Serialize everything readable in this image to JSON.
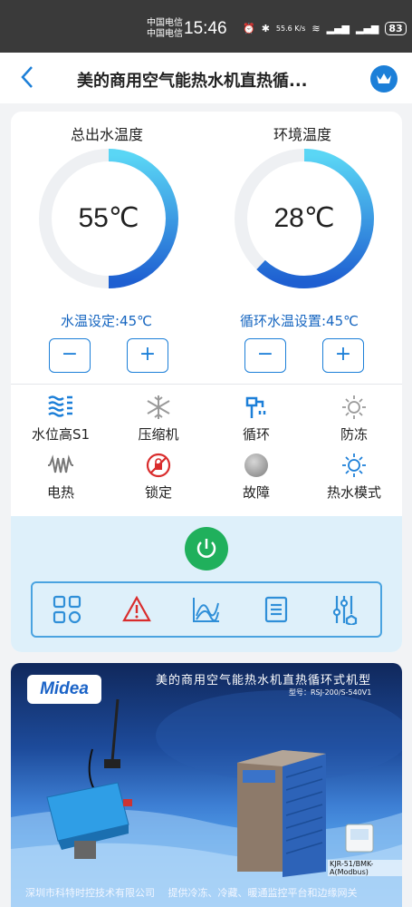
{
  "status_bar": {
    "carrier_1": "中国电信",
    "carrier_2": "中国电信",
    "time": "15:46",
    "net_speed": "55.6 K/s",
    "battery": "83"
  },
  "header": {
    "title": "美的商用空气能热水机直热循...",
    "back_icon": "chevron-left-icon",
    "crown_icon": "crown-icon"
  },
  "gauges": [
    {
      "label": "总出水温度",
      "value": "55℃",
      "fill_fraction": 0.5,
      "setting": "水温设定:45℃"
    },
    {
      "label": "环境温度",
      "value": "28℃",
      "fill_fraction": 0.62,
      "setting": "循环水温设置:45℃"
    }
  ],
  "steppers": {
    "minus": "−",
    "plus": "+"
  },
  "status_items": [
    {
      "label": "水位高S1",
      "icon": "water-level-icon",
      "active": true
    },
    {
      "label": "压缩机",
      "icon": "snowflake-icon",
      "active": false
    },
    {
      "label": "循环",
      "icon": "pump-icon",
      "active": true
    },
    {
      "label": "防冻",
      "icon": "sun-icon",
      "active": false
    },
    {
      "label": "电热",
      "icon": "heater-icon",
      "active": false
    },
    {
      "label": "锁定",
      "icon": "lock-prohibited-icon",
      "active": false
    },
    {
      "label": "故障",
      "icon": "fault-dot-icon",
      "active": false
    },
    {
      "label": "热水模式",
      "icon": "sun-icon",
      "active": true
    }
  ],
  "toolbar": [
    "grid-icon",
    "alert-icon",
    "curve-chart-icon",
    "list-icon",
    "sliders-icon"
  ],
  "colors": {
    "accent": "#1c7fd8",
    "gauge_gradient_start": "#1e5fd1",
    "gauge_gradient_end": "#5ad6f5",
    "power_green": "#20b05c",
    "alert_red": "#d92c2c"
  },
  "banner": {
    "brand": "Midea",
    "title": "美的商用空气能热水机直热循环式机型",
    "model": "型号：RSJ-200/S-540V1",
    "sub_caption": "KJR-51/BMK-A(Modbus)",
    "footer": "深圳市科特时控技术有限公司　 提供冷冻、冷藏、暖通监控平台和边缘网关"
  }
}
